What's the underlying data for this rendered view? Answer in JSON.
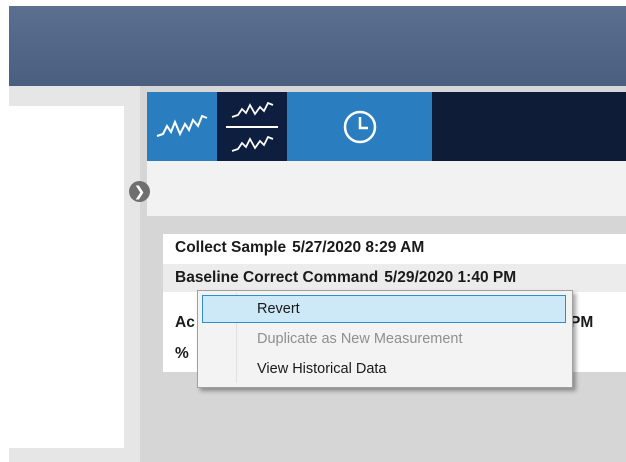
{
  "toolbar": {
    "buttons": [
      {
        "icon": "spectrum-icon"
      },
      {
        "icon": "split-spectrum-icon"
      },
      {
        "icon": "clock-icon"
      }
    ]
  },
  "history": {
    "rows": [
      {
        "label": "Collect Sample",
        "date": "5/27/2020 8:29 AM"
      },
      {
        "label": "Baseline Correct Command",
        "date": "5/29/2020 1:40 PM"
      },
      {
        "label": "Ac",
        "date": "PM"
      },
      {
        "label": "%",
        "date": ""
      }
    ]
  },
  "context_menu": {
    "items": [
      {
        "label": "Revert",
        "state": "highlighted"
      },
      {
        "label": "Duplicate as New Measurement",
        "state": "disabled"
      },
      {
        "label": "View Historical Data",
        "state": "enabled"
      }
    ]
  },
  "colors": {
    "titlebar": "#4f6385",
    "toolbar_dark": "#0f1c38",
    "toolbar_blue": "#2a7ec0",
    "menu_highlight": "#cde8f7",
    "menu_highlight_border": "#2e8fd0"
  }
}
